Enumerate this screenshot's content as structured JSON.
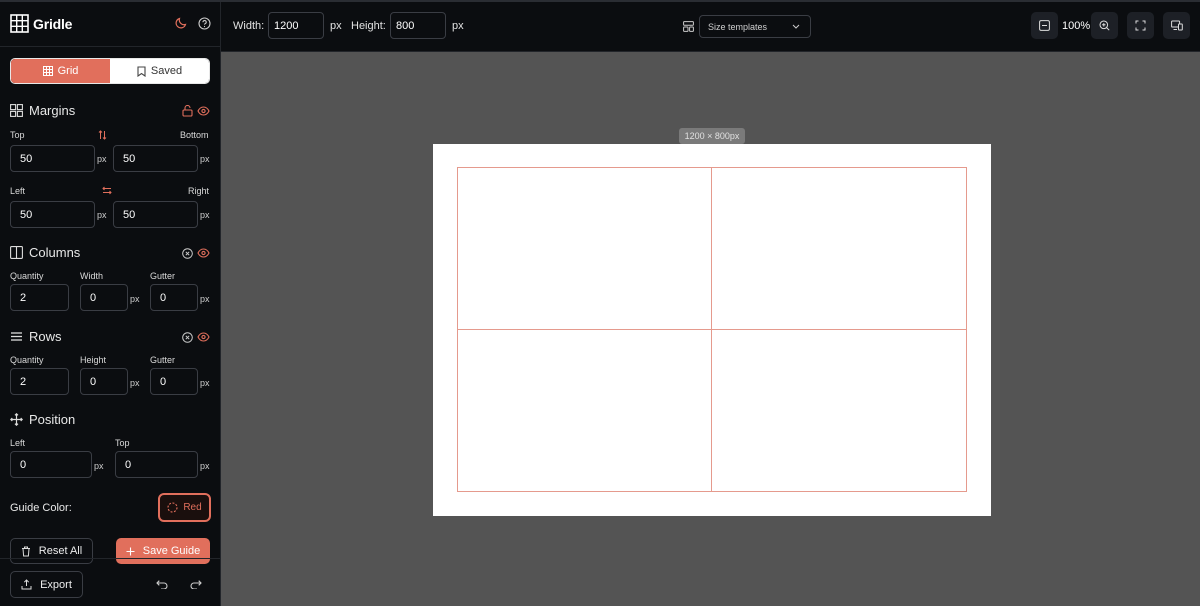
{
  "app": {
    "name": "Gridle"
  },
  "tabs": {
    "grid": "Grid",
    "saved": "Saved"
  },
  "margins": {
    "title": "Margins",
    "top_label": "Top",
    "bottom_label": "Bottom",
    "left_label": "Left",
    "right_label": "Right",
    "top": "50",
    "bottom": "50",
    "left": "50",
    "right": "50",
    "unit": "px"
  },
  "columns": {
    "title": "Columns",
    "quantity_label": "Quantity",
    "width_label": "Width",
    "gutter_label": "Gutter",
    "quantity": "2",
    "width": "0",
    "gutter": "0",
    "unit": "px"
  },
  "rows": {
    "title": "Rows",
    "quantity_label": "Quantity",
    "height_label": "Height",
    "gutter_label": "Gutter",
    "quantity": "2",
    "height": "0",
    "gutter": "0",
    "unit": "px"
  },
  "position": {
    "title": "Position",
    "left_label": "Left",
    "top_label": "Top",
    "left": "0",
    "top": "0",
    "unit": "px"
  },
  "guide_color": {
    "label": "Guide Color:",
    "value": "Red",
    "hex": "#e16f5c"
  },
  "actions": {
    "reset": "Reset All",
    "save": "Save Guide",
    "export": "Export"
  },
  "toolbar": {
    "width_label": "Width:",
    "width": "1200",
    "width_unit": "px",
    "height_label": "Height:",
    "height": "800",
    "height_unit": "px",
    "templates": "Size templates",
    "zoom": "100%"
  },
  "canvas": {
    "size_badge": "1200 × 800px"
  },
  "colors": {
    "accent": "#e16f5c",
    "guide": "#e59a8d",
    "canvas_bg": "#545454",
    "sidebar_bg": "#0b0d10"
  }
}
